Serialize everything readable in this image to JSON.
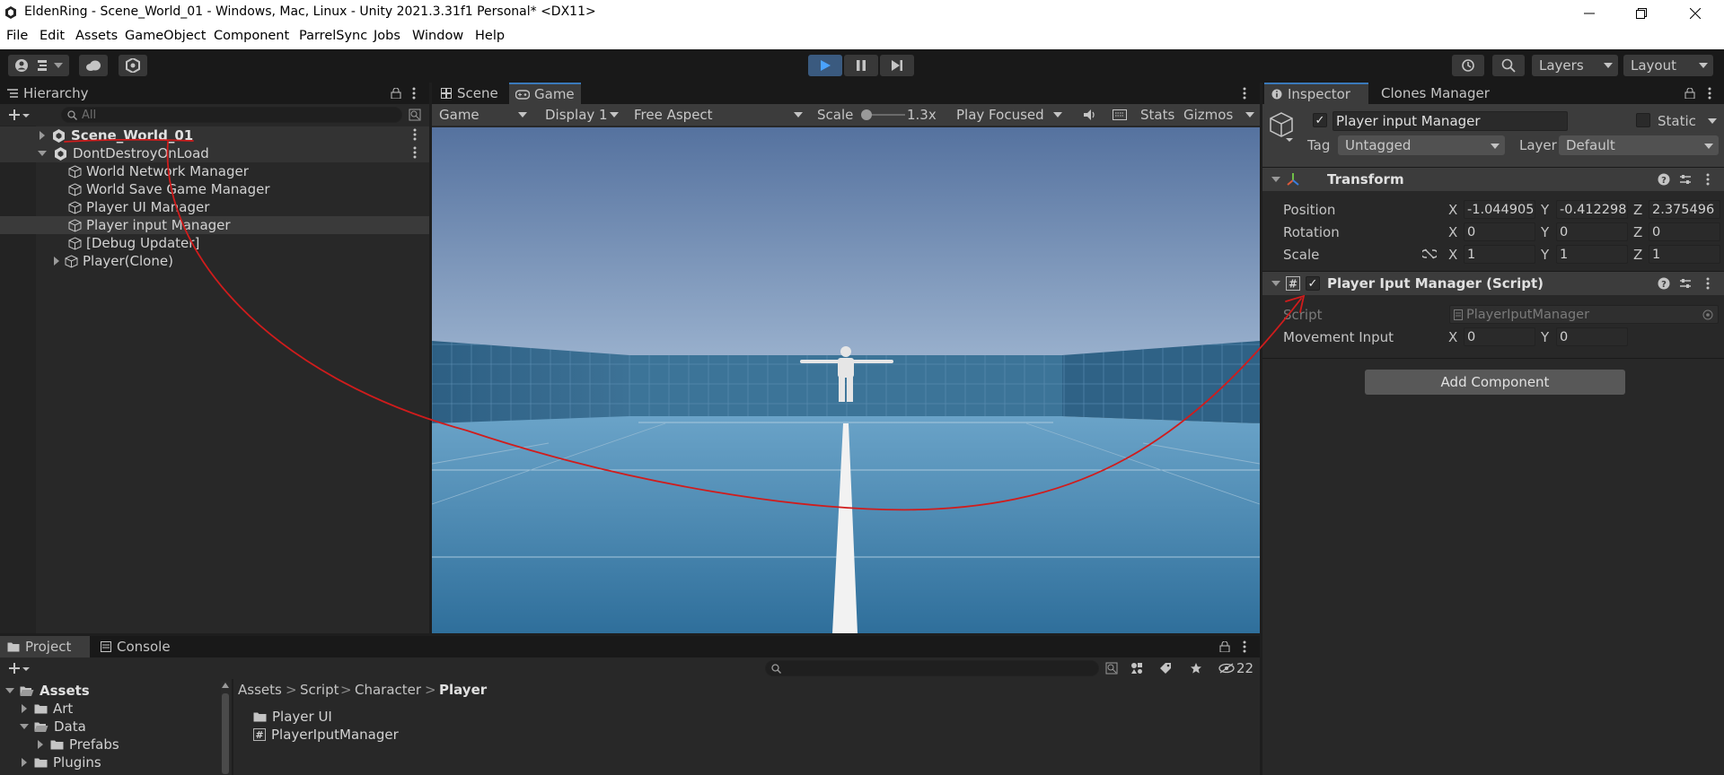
{
  "window": {
    "title": "EldenRing - Scene_World_01 - Windows, Mac, Linux - Unity 2021.3.31f1 Personal* <DX11>",
    "controls": [
      "minimize-icon",
      "restore-icon",
      "close-icon"
    ]
  },
  "menu": [
    "File",
    "Edit",
    "Assets",
    "GameObject",
    "Component",
    "ParrelSync",
    "Jobs",
    "Window",
    "Help"
  ],
  "toolbar": {
    "layers_label": "Layers",
    "layout_label": "Layout"
  },
  "hierarchy": {
    "tab_label": "Hierarchy",
    "search_placeholder": "All",
    "scene": "Scene_World_01",
    "dont_destroy": "DontDestroyOnLoad",
    "items": [
      "World Network Manager",
      "World Save Game Manager",
      "Player UI Manager",
      "Player input Manager",
      "[Debug Updater]",
      "Player(Clone)"
    ],
    "selected_index": 3
  },
  "game": {
    "tabs": [
      "Scene",
      "Game"
    ],
    "active_tab": "Game",
    "view_dropdown": "Game",
    "display": "Display 1",
    "aspect": "Free Aspect",
    "scale_label": "Scale",
    "scale_value": "1.3x",
    "play_mode": "Play Focused",
    "stats": "Stats",
    "gizmos": "Gizmos"
  },
  "inspector": {
    "tabs": [
      "Inspector",
      "Clones Manager"
    ],
    "active_tab": "Inspector",
    "object_name": "Player input Manager",
    "static_label": "Static",
    "tag_label": "Tag",
    "tag_value": "Untagged",
    "layer_label": "Layer",
    "layer_value": "Default",
    "transform": {
      "title": "Transform",
      "position_label": "Position",
      "rotation_label": "Rotation",
      "scale_label": "Scale",
      "position": {
        "x": "-1.044905",
        "y": "-0.412298",
        "z": "2.375496"
      },
      "rotation": {
        "x": "0",
        "y": "0",
        "z": "0"
      },
      "scale": {
        "x": "1",
        "y": "1",
        "z": "1"
      }
    },
    "script_component": {
      "title": "Player Iput Manager (Script)",
      "script_label": "Script",
      "script_value": "PlayerIputManager",
      "movement_label": "Movement Input",
      "movement": {
        "x": "0",
        "y": "0"
      }
    },
    "add_component": "Add Component"
  },
  "project": {
    "tabs": [
      "Project",
      "Console"
    ],
    "active_tab": "Project",
    "hidden_count": "22",
    "tree": [
      {
        "label": "Assets",
        "depth": 0,
        "expanded": true,
        "bold": true
      },
      {
        "label": "Art",
        "depth": 1,
        "expanded": false
      },
      {
        "label": "Data",
        "depth": 1,
        "expanded": true
      },
      {
        "label": "Prefabs",
        "depth": 2,
        "expanded": false
      },
      {
        "label": "Plugins",
        "depth": 1,
        "expanded": false
      }
    ],
    "breadcrumb": [
      "Assets",
      "Script",
      "Character",
      "Player"
    ],
    "files": [
      {
        "label": "Player UI",
        "kind": "folder"
      },
      {
        "label": "PlayerIputManager",
        "kind": "script"
      }
    ]
  },
  "colors": {
    "accent": "#3a79bb",
    "annotation": "#d01c1c",
    "sky_top": "#55729f",
    "floor": "#3f7fae"
  }
}
